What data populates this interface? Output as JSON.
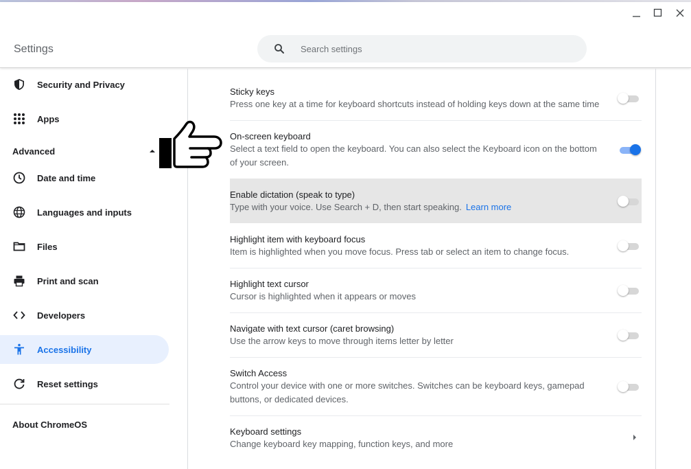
{
  "app": {
    "title": "Settings"
  },
  "search": {
    "placeholder": "Search settings",
    "value": ""
  },
  "window_controls": {
    "minimize": "minimize-icon",
    "maximize": "maximize-icon",
    "close": "close-icon"
  },
  "sidebar": {
    "items_top": [
      {
        "label": "Security and Privacy",
        "icon": "shield-icon"
      },
      {
        "label": "Apps",
        "icon": "apps-grid-icon"
      }
    ],
    "advanced_label": "Advanced",
    "items_advanced": [
      {
        "label": "Date and time",
        "icon": "clock-icon"
      },
      {
        "label": "Languages and inputs",
        "icon": "globe-icon"
      },
      {
        "label": "Files",
        "icon": "folder-icon"
      },
      {
        "label": "Print and scan",
        "icon": "printer-icon"
      },
      {
        "label": "Developers",
        "icon": "code-icon"
      },
      {
        "label": "Accessibility",
        "icon": "accessibility-icon",
        "active": true
      },
      {
        "label": "Reset settings",
        "icon": "reset-icon"
      }
    ],
    "about": "About ChromeOS"
  },
  "settings": [
    {
      "title": "Sticky keys",
      "desc": "Press one key at a time for keyboard shortcuts instead of holding keys down at the same time",
      "on": false
    },
    {
      "title": "On-screen keyboard",
      "desc": "Select a text field to open the keyboard. You can also select the Keyboard icon on the bottom of your screen.",
      "on": true
    },
    {
      "title": "Enable dictation (speak to type)",
      "desc": "Type with your voice. Use Search + D, then start speaking.",
      "link": "Learn more",
      "on": false
    },
    {
      "title": "Highlight item with keyboard focus",
      "desc": "Item is highlighted when you move focus. Press tab or select an item to change focus.",
      "on": false
    },
    {
      "title": "Highlight text cursor",
      "desc": "Cursor is highlighted when it appears or moves",
      "on": false
    },
    {
      "title": "Navigate with text cursor (caret browsing)",
      "desc": "Use the arrow keys to move through items letter by letter",
      "on": false
    },
    {
      "title": "Switch Access",
      "desc": "Control your device with one or more switches. Switches can be keyboard keys, gamepad buttons, or dedicated devices.",
      "on": false
    },
    {
      "title": "Keyboard settings",
      "desc": "Change keyboard key mapping, function keys, and more"
    }
  ],
  "colors": {
    "accent": "#1a73e8",
    "active_bg": "#e8f0fe",
    "hover_row": "#e6e6e6"
  }
}
